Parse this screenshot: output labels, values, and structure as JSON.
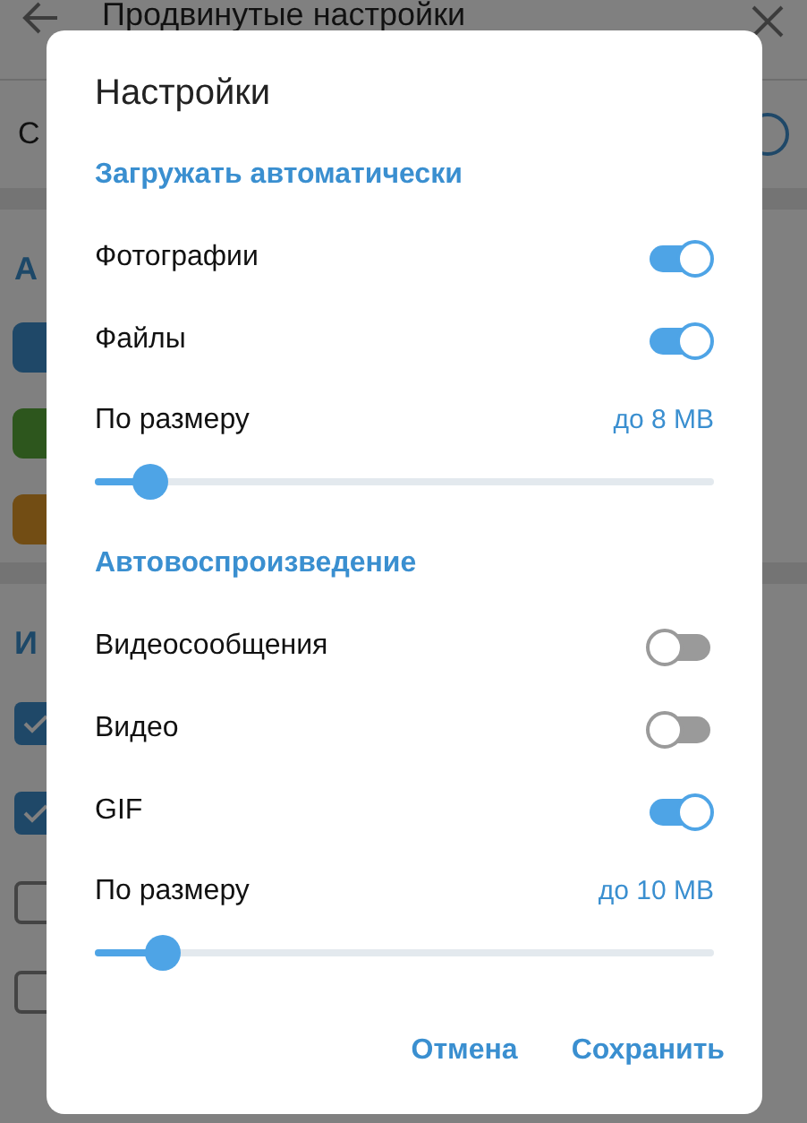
{
  "page": {
    "title": "Продвинутые настройки",
    "toggle_row": {
      "label": "С",
      "on": true
    },
    "sections": [
      {
        "title": "А",
        "items": [
          {
            "kind": "icon",
            "color": "#1f4868"
          },
          {
            "kind": "icon",
            "color": "#2d561d"
          },
          {
            "kind": "icon",
            "color": "#724d14"
          }
        ]
      },
      {
        "title": "И",
        "items": [
          {
            "kind": "checkbox",
            "checked": true
          },
          {
            "kind": "checkbox",
            "checked": true
          },
          {
            "kind": "checkbox",
            "checked": false
          },
          {
            "kind": "checkbox",
            "checked": false
          }
        ]
      }
    ]
  },
  "dialog": {
    "title": "Настройки",
    "sections": [
      {
        "title": "Загружать автоматически",
        "items": [
          {
            "kind": "toggle",
            "label": "Фотографии",
            "on": true
          },
          {
            "kind": "toggle",
            "label": "Файлы",
            "on": true
          },
          {
            "kind": "slider",
            "label": "По размеру",
            "value": "до 8 MB",
            "level": 0.09
          }
        ]
      },
      {
        "title": "Автовоспроизведение",
        "items": [
          {
            "kind": "toggle",
            "label": "Видеосообщения",
            "on": false
          },
          {
            "kind": "toggle",
            "label": "Видео",
            "on": false
          },
          {
            "kind": "toggle",
            "label": "GIF",
            "on": true
          },
          {
            "kind": "slider",
            "label": "По размеру",
            "value": "до 10 MB",
            "level": 0.11
          }
        ]
      }
    ],
    "buttons": [
      "Отмена",
      "Сохранить"
    ]
  }
}
